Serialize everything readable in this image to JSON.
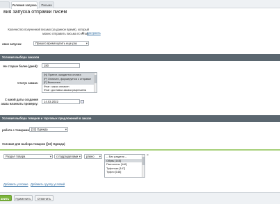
{
  "tabs": [
    {
      "label": "",
      "active": false
    },
    {
      "label": "Условия запуска",
      "active": true
    },
    {
      "label": "Письма",
      "active": false
    }
  ],
  "page_title": "вия запуска отправки писем",
  "counter": {
    "line1": "Количество полученной письмо (за данное время), который",
    "line2": "можно отправить письма по email:",
    "value": "3",
    "link": "настроить"
  },
  "trigger": {
    "label": "овие запуска:",
    "value": "Пришло время купить еще раз"
  },
  "section_orders": "Условия выбора заказов",
  "not_older": {
    "label": "Не старше более (дней):",
    "value": "180"
  },
  "order_status": {
    "label": "Статус заказа:",
    "options": [
      {
        "text": "[N] Принят, ожидается оплата",
        "selected": true
      },
      {
        "text": "[P] Оплачен, формируется к отправке",
        "selected": true
      },
      {
        "text": "[F] Выполнен",
        "selected": true
      },
      {
        "text": "Флаг: заказ оплачен",
        "selected": false
      },
      {
        "text": "Флаг: доставка заказа разрешена",
        "selected": false
      }
    ]
  },
  "check_date": {
    "label_line1": "С какой даты создания",
    "label_line2": "аказа начинать проверку:",
    "value": "14.03.2022"
  },
  "section_goods": "Условия выбора товаров и торговых предложений в заказе",
  "work_with": {
    "label": "работа с товарами:",
    "value": "[32] Одежда"
  },
  "conditions_title": "Условия для выбора товаров ([32] Одежда)",
  "condition": {
    "field": "Раздел товара",
    "operator": "с подразделами",
    "compare": "равно",
    "values": [
      {
        "text": "-- Без раздела --",
        "selected": false
      },
      {
        "text": "Обувь [145]",
        "selected": true
      },
      {
        "text": "Пантолеты [146]",
        "selected": false
      },
      {
        "text": "Туфельки [147]",
        "selected": false
      },
      {
        "text": "Туфли [148]",
        "selected": false
      }
    ],
    "remove": "×"
  },
  "add_condition": "Добавить условие",
  "add_group": "Добавить группу условий",
  "footer": {
    "save": "анить",
    "apply": "Применить",
    "cancel": "Отменить"
  }
}
